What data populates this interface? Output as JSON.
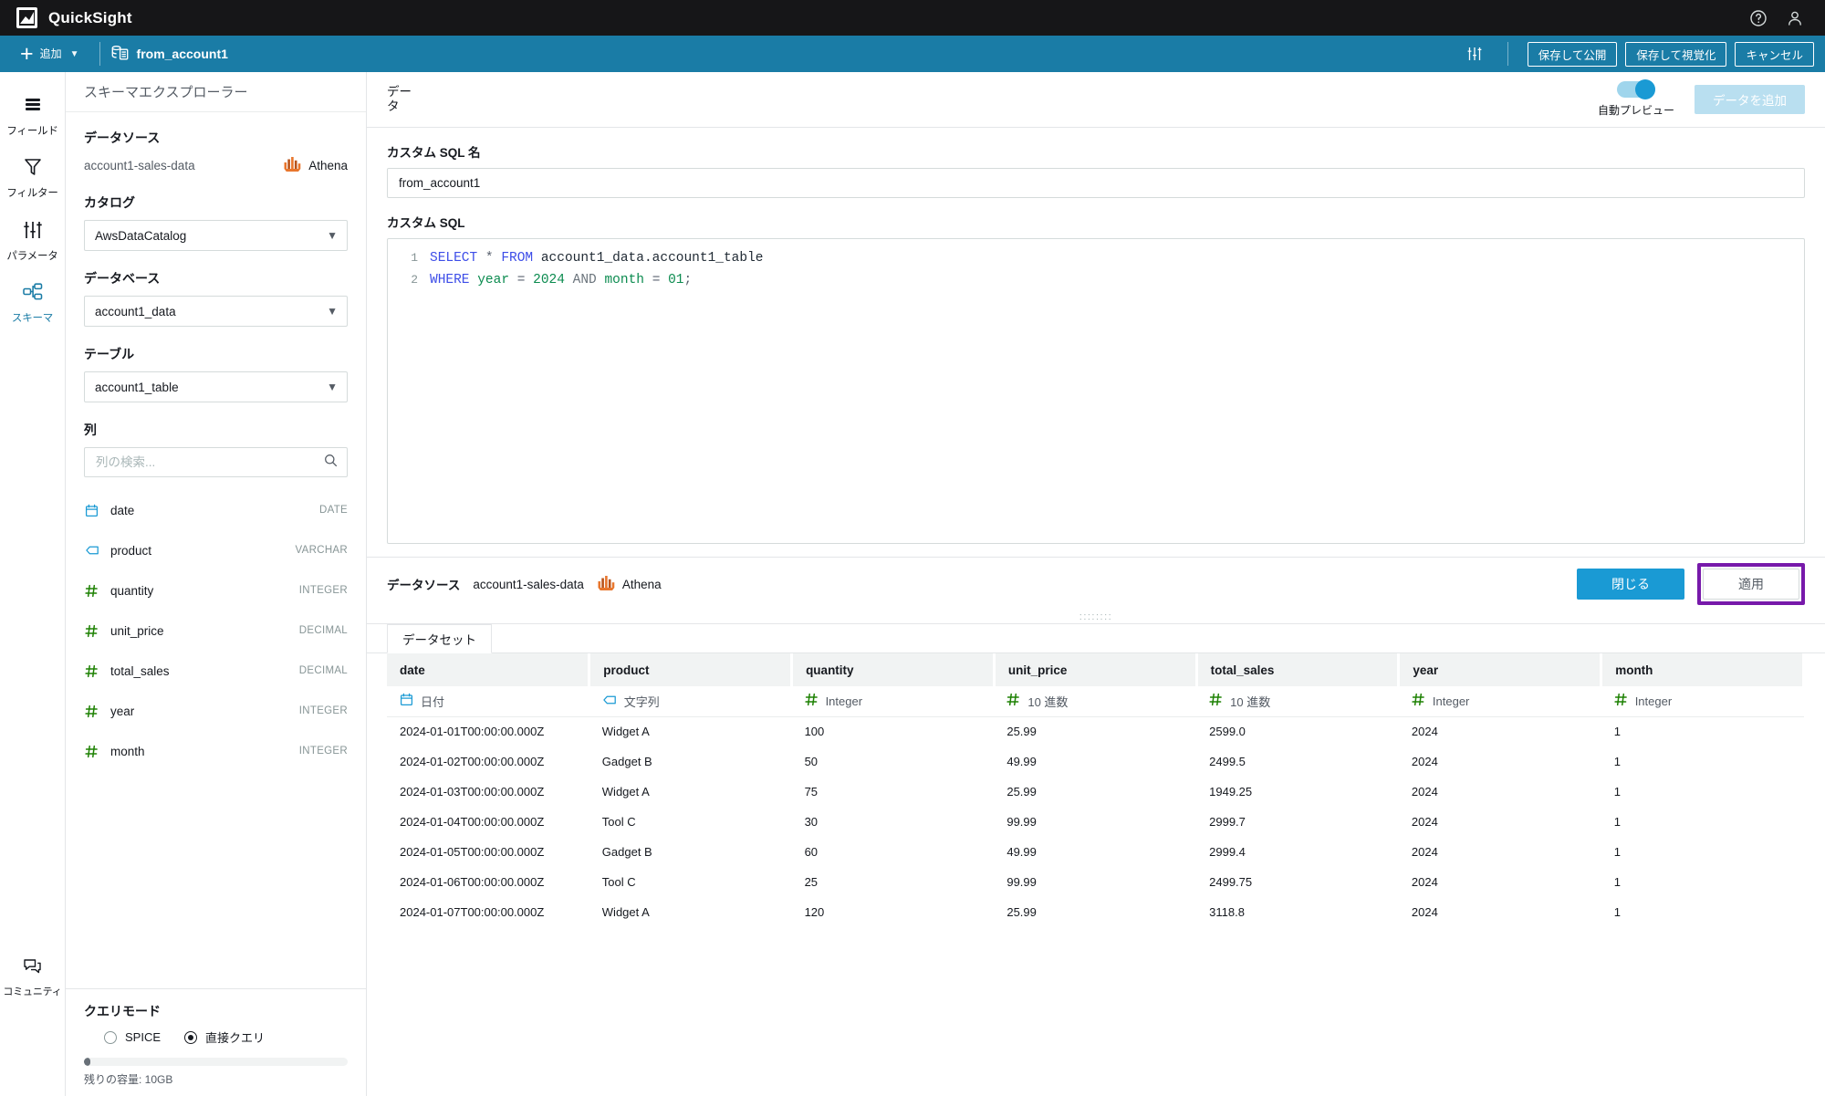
{
  "topbar": {
    "product_name": "QuickSight",
    "logo_icon": "quicksight-logo-icon",
    "help_icon": "help-circle-icon",
    "account_icon": "user-account-icon"
  },
  "actionbar": {
    "add_label": "追加",
    "add_icon": "plus-icon",
    "add_chevron_icon": "chevron-down-icon",
    "dataset_icon": "dataset-icon",
    "dataset_name": "from_account1",
    "settings_icon": "sliders-icon",
    "buttons": [
      {
        "label": "保存して公開",
        "name": "save-publish-button"
      },
      {
        "label": "保存して視覚化",
        "name": "save-visualize-button"
      },
      {
        "label": "キャンセル",
        "name": "cancel-button"
      }
    ]
  },
  "rail": {
    "items": [
      {
        "label": "フィールド",
        "icon": "fields-icon",
        "active": false
      },
      {
        "label": "フィルター",
        "icon": "filter-icon",
        "active": false
      },
      {
        "label": "パラメータ",
        "icon": "parameters-icon",
        "active": false
      },
      {
        "label": "スキーマ",
        "icon": "schema-icon",
        "active": true
      }
    ],
    "community": {
      "label": "コミュニティ",
      "icon": "community-chat-icon"
    }
  },
  "schema": {
    "title": "スキーマエクスプローラー",
    "datasource_label": "データソース",
    "datasource_name": "account1-sales-data",
    "engine_name": "Athena",
    "engine_icon": "athena-icon",
    "catalog_label": "カタログ",
    "catalog_value": "AwsDataCatalog",
    "database_label": "データベース",
    "database_value": "account1_data",
    "table_label": "テーブル",
    "table_value": "account1_table",
    "columns_label": "列",
    "column_search_placeholder": "列の検索...",
    "column_search_value": "",
    "search_icon": "search-icon",
    "columns": [
      {
        "name": "date",
        "type": "DATE",
        "icon": "calendar-icon"
      },
      {
        "name": "product",
        "type": "VARCHAR",
        "icon": "string-tag-icon"
      },
      {
        "name": "quantity",
        "type": "INTEGER",
        "icon": "number-hash-icon"
      },
      {
        "name": "unit_price",
        "type": "DECIMAL",
        "icon": "number-hash-icon"
      },
      {
        "name": "total_sales",
        "type": "DECIMAL",
        "icon": "number-hash-icon"
      },
      {
        "name": "year",
        "type": "INTEGER",
        "icon": "number-hash-icon"
      },
      {
        "name": "month",
        "type": "INTEGER",
        "icon": "number-hash-icon"
      }
    ]
  },
  "query_mode": {
    "title": "クエリモード",
    "options": [
      {
        "label": "SPICE",
        "selected": false
      },
      {
        "label": "直接クエリ",
        "selected": true
      }
    ],
    "capacity_text": "残りの容量: 10GB",
    "capacity_percent": 2
  },
  "main": {
    "panel_title": "データ",
    "auto_preview_label": "自動プレビュー",
    "auto_preview_on": true,
    "add_data_label": "データを追加",
    "sql_name_label": "カスタム SQL 名",
    "sql_name_value": "from_account1",
    "sql_label": "カスタム SQL",
    "sql_lines": [
      {
        "no": "1",
        "tokens": [
          {
            "t": "SELECT",
            "c": "kw"
          },
          {
            "t": " ",
            "c": "plain"
          },
          {
            "t": "*",
            "c": "op"
          },
          {
            "t": " ",
            "c": "plain"
          },
          {
            "t": "FROM",
            "c": "kw"
          },
          {
            "t": " ",
            "c": "plain"
          },
          {
            "t": "account1_data.account1_table",
            "c": "ident"
          }
        ]
      },
      {
        "no": "2",
        "tokens": [
          {
            "t": "WHERE",
            "c": "kw"
          },
          {
            "t": " ",
            "c": "plain"
          },
          {
            "t": "year",
            "c": "grn"
          },
          {
            "t": " ",
            "c": "plain"
          },
          {
            "t": "=",
            "c": "op"
          },
          {
            "t": " ",
            "c": "plain"
          },
          {
            "t": "2024",
            "c": "num"
          },
          {
            "t": " ",
            "c": "plain"
          },
          {
            "t": "AND",
            "c": "gry"
          },
          {
            "t": " ",
            "c": "plain"
          },
          {
            "t": "month",
            "c": "grn"
          },
          {
            "t": " ",
            "c": "plain"
          },
          {
            "t": "=",
            "c": "op"
          },
          {
            "t": " ",
            "c": "plain"
          },
          {
            "t": "01",
            "c": "num"
          },
          {
            "t": ";",
            "c": "op"
          }
        ]
      }
    ],
    "footer": {
      "datasource_label": "データソース",
      "datasource_name": "account1-sales-data",
      "engine_name": "Athena",
      "engine_icon": "athena-icon",
      "close_label": "閉じる",
      "apply_label": "適用",
      "apply_highlight_color": "#7719aa"
    }
  },
  "preview": {
    "tab_label": "データセット",
    "drag_handle_icon": "drag-handle-icon",
    "columns": [
      {
        "header": "date",
        "type_label": "日付",
        "type_icon": "calendar-icon"
      },
      {
        "header": "product",
        "type_label": "文字列",
        "type_icon": "string-tag-icon"
      },
      {
        "header": "quantity",
        "type_label": "Integer",
        "type_icon": "number-hash-icon"
      },
      {
        "header": "unit_price",
        "type_label": "10 進数",
        "type_icon": "number-hash-icon"
      },
      {
        "header": "total_sales",
        "type_label": "10 進数",
        "type_icon": "number-hash-icon"
      },
      {
        "header": "year",
        "type_label": "Integer",
        "type_icon": "number-hash-icon"
      },
      {
        "header": "month",
        "type_label": "Integer",
        "type_icon": "number-hash-icon"
      }
    ],
    "rows": [
      [
        "2024-01-01T00:00:00.000Z",
        "Widget A",
        "100",
        "25.99",
        "2599.0",
        "2024",
        "1"
      ],
      [
        "2024-01-02T00:00:00.000Z",
        "Gadget B",
        "50",
        "49.99",
        "2499.5",
        "2024",
        "1"
      ],
      [
        "2024-01-03T00:00:00.000Z",
        "Widget A",
        "75",
        "25.99",
        "1949.25",
        "2024",
        "1"
      ],
      [
        "2024-01-04T00:00:00.000Z",
        "Tool C",
        "30",
        "99.99",
        "2999.7",
        "2024",
        "1"
      ],
      [
        "2024-01-05T00:00:00.000Z",
        "Gadget B",
        "60",
        "49.99",
        "2999.4",
        "2024",
        "1"
      ],
      [
        "2024-01-06T00:00:00.000Z",
        "Tool C",
        "25",
        "99.99",
        "2499.75",
        "2024",
        "1"
      ],
      [
        "2024-01-07T00:00:00.000Z",
        "Widget A",
        "120",
        "25.99",
        "3118.8",
        "2024",
        "1"
      ]
    ]
  },
  "colors": {
    "brand_blue": "#1a7ca6",
    "accent_blue": "#1a9ad4",
    "highlight_purple": "#7719aa",
    "athena_orange": "#e8762d",
    "number_green": "#1d8102"
  }
}
